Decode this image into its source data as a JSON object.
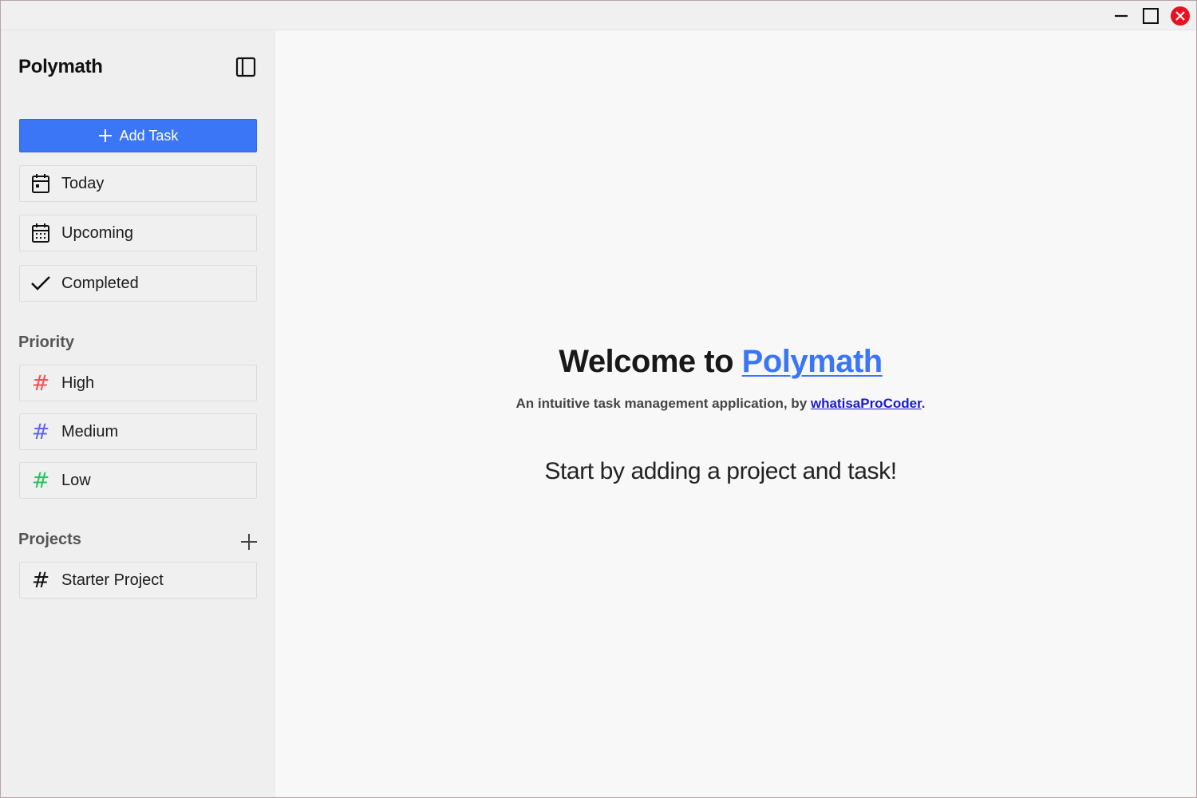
{
  "window": {
    "controls": {
      "minimize_icon": "minimize-icon",
      "maximize_icon": "maximize-icon",
      "close_icon": "close-icon"
    },
    "colors": {
      "close": "#e81123"
    }
  },
  "sidebar": {
    "brand": "Polymath",
    "toggle_icon": "sidebar-toggle-icon",
    "add_task": {
      "icon": "plus-icon",
      "label": "Add Task"
    },
    "nav": [
      {
        "label": "Today",
        "icon": "calendar-today-icon"
      },
      {
        "label": "Upcoming",
        "icon": "calendar-grid-icon"
      },
      {
        "label": "Completed",
        "icon": "check-icon"
      }
    ],
    "priority": {
      "title": "Priority",
      "items": [
        {
          "label": "High",
          "symbol": "#",
          "color": "#f05252"
        },
        {
          "label": "Medium",
          "symbol": "#",
          "color": "#6366f1"
        },
        {
          "label": "Low",
          "symbol": "#",
          "color": "#22c55e"
        }
      ]
    },
    "projects": {
      "title": "Projects",
      "add_icon": "plus-icon",
      "items": [
        {
          "label": "Starter Project",
          "symbol": "#",
          "color": "#111111"
        }
      ]
    }
  },
  "main": {
    "welcome_prefix": "Welcome to ",
    "welcome_link": "Polymath",
    "subtitle_prefix": "An intuitive task management application, by ",
    "subtitle_link": "whatisaProCoder",
    "subtitle_suffix": ".",
    "start_text": "Start by adding a project and task!"
  },
  "colors": {
    "accent": "#3b76f6",
    "sidebar_bg": "#efefef",
    "main_bg": "#f8f8f8"
  }
}
